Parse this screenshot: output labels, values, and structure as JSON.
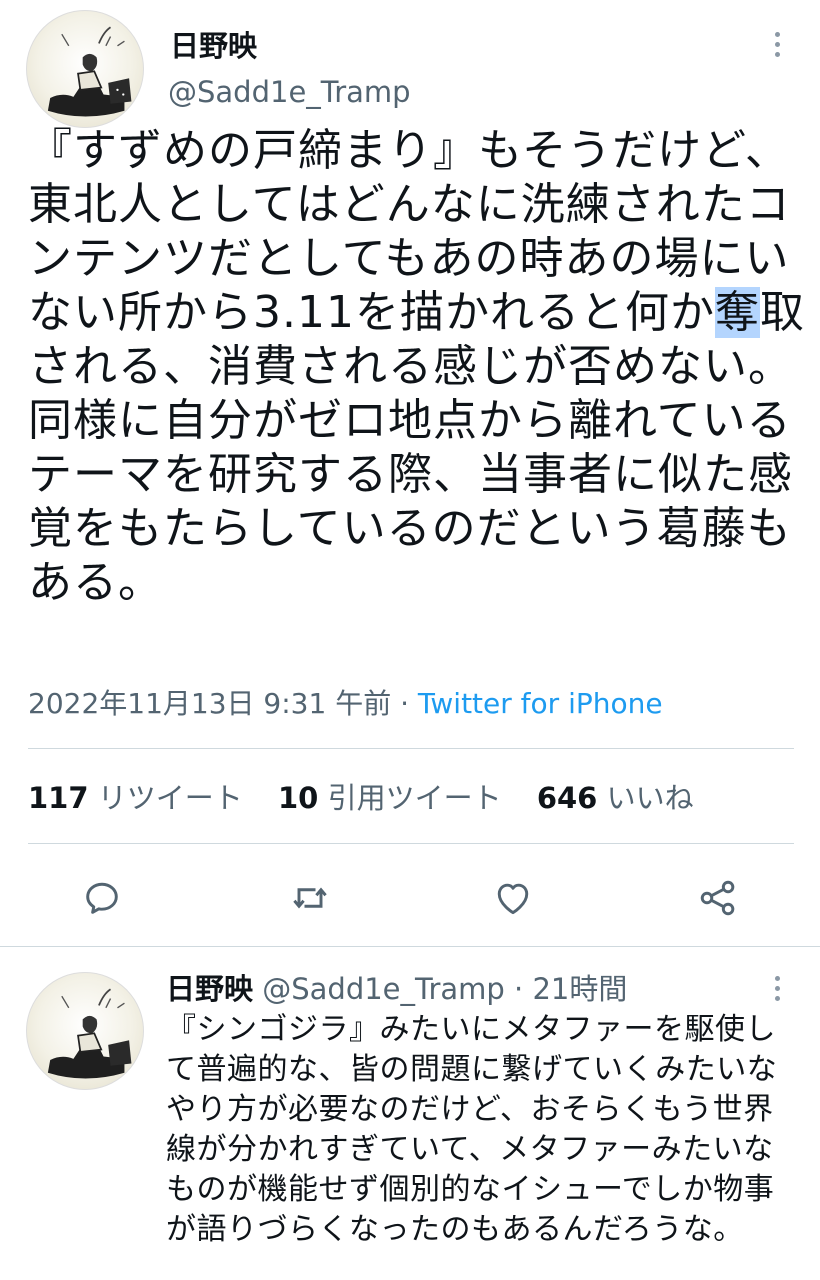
{
  "main_tweet": {
    "author_name": "日野映",
    "author_handle": "@Sadd1e_Tramp",
    "text_lines": [
      "『すずめの戸締まり』もそうだけど、",
      "東北人としてはどんなに洗練されたコ",
      "ンテンツだとしてもあの時あの場にい",
      "ない所から3.11を描かれると何か",
      "される、消費される感じが否めない。",
      "同様に自分がゼロ地点から離れている",
      "テーマを研究する際、当事者に似た感",
      "覚をもたらしているのだという葛藤も",
      "ある。"
    ],
    "highlighted_text": "奪",
    "after_highlight": "取",
    "timestamp": "2022年11月13日 9:31 午前",
    "separator": "·",
    "source": "Twitter for iPhone"
  },
  "stats": {
    "retweets_count": "117",
    "retweets_label": "リツイート",
    "quotes_count": "10",
    "quotes_label": "引用ツイート",
    "likes_count": "646",
    "likes_label": "いいね"
  },
  "actions": [
    "reply-icon",
    "retweet-icon",
    "like-icon",
    "share-icon"
  ],
  "reply_tweet": {
    "author_name": "日野映",
    "author_handle": "@Sadd1e_Tramp",
    "separator": "·",
    "time_ago": "21時間",
    "text_lines": [
      "『シンゴジラ』みたいにメタファーを駆使し",
      "て普遍的な、皆の問題に繋げていくみたいな",
      "やり方が必要なのだけど、おそらくもう世界",
      "線が分かれすぎていて、メタファーみたいな",
      "ものが機能せず個別的なイシューでしか物事",
      "が語りづらくなったのもあるんだろうな。"
    ]
  },
  "colors": {
    "text": "#0f1419",
    "secondary": "#536471",
    "link": "#1d9bf0",
    "selection": "#b4d5fe",
    "divider": "#cfd9de"
  }
}
